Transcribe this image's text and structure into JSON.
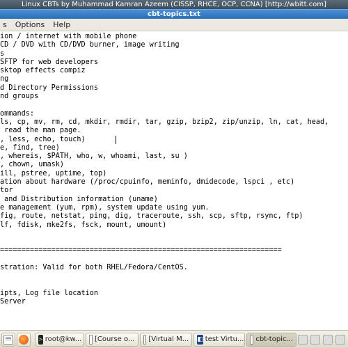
{
  "window": {
    "outer_title": "Linux CBTs by Muhammad Kamran Azeem (CISSP, RHCE, OCP, CCNA) [http://wbitt.com]",
    "inner_title": "cbt-topics.txt"
  },
  "menu": {
    "items": [
      "s",
      "Options",
      "Help"
    ]
  },
  "editor": {
    "lines": [
      "ion / internet with mobile phone",
      "CD / DVD with CD/DVD burner, image writing",
      "s",
      "SFTP for web developers",
      "sktop effects compiz",
      "ng",
      "d Directory Permissions",
      "nd groups",
      "",
      "ommands:",
      "ls, cp, mv, rm, cd, mkdir, rmdir, tar, gzip, bzip2, zip/unzip, ln, cat, head,",
      " read the man page.",
      ", less, echo, touch)",
      "e, find, tree)",
      ", whereis, $PATH, who, w, whoami, last, su )",
      ", chown, umask)",
      "ill, pstree, uptime, top)",
      "ation about hardware (/proc/cpuinfo, meminfo, dmidecode, lspci , etc)",
      "tor",
      " and Distribution information (uname)",
      "e management (yum, rpm), system update using yum.",
      "fig, route, netstat, ping, dig, traceroute, ssh, scp, sftp, rsync, ftp)",
      "lf, fdisk, mke2fs, fsck, mount, umount)",
      "",
      "",
      "==================================================================",
      "",
      "stration: Valid for both RHEL/Fedora/CentOS.",
      "",
      "",
      "ipts, Log file location",
      "Server",
      "",
      "",
      "",
      ""
    ],
    "cursor": {
      "line": 12,
      "col": 27
    }
  },
  "taskbar": {
    "items": [
      {
        "label": "root@kw...",
        "icon": "term",
        "active": false
      },
      {
        "label": "[Course o...",
        "icon": "doc",
        "active": false
      },
      {
        "label": "[Virtual M...",
        "icon": "doc",
        "active": false
      },
      {
        "label": "test Virtu...",
        "icon": "vbox",
        "active": false
      },
      {
        "label": "cbt-topic...",
        "icon": "doc",
        "active": true
      }
    ]
  }
}
